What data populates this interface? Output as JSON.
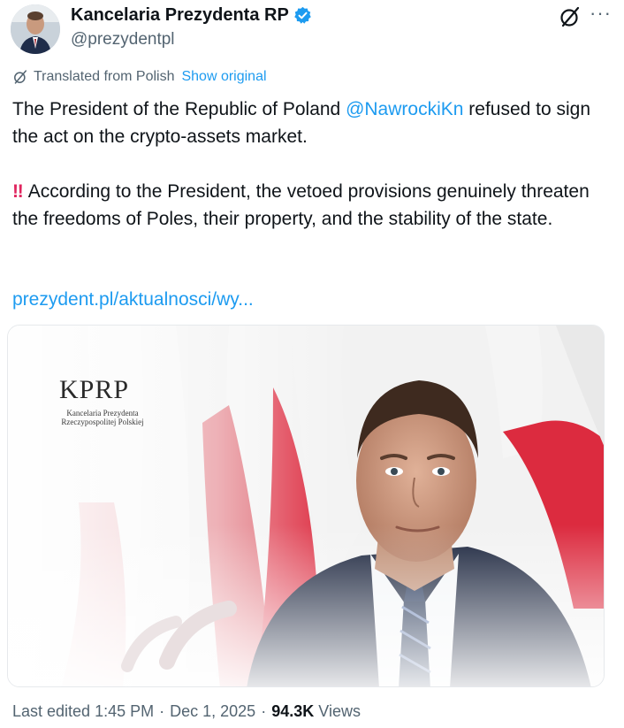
{
  "account": {
    "name": "Kancelaria Prezydenta RP",
    "handle": "@prezydentpl",
    "verified_icon": "verified-badge-icon"
  },
  "translation": {
    "label": "Translated from Polish",
    "show_original": "Show original"
  },
  "tweet": {
    "p1_start": "The President of the Republic of Poland ",
    "mention": "@NawrockiKn",
    "p1_end": " refused to sign the act on the crypto-assets market.",
    "bang": "‼",
    "p2": "According to the President, the vetoed provisions genuinely threaten the freedoms of Poles, their property, and the stability of the state.",
    "link": "prezydent.pl/aktualnosci/wy..."
  },
  "media": {
    "logo": "KPRP",
    "logo_sub": "Kancelaria Prezydenta Rzeczypospolitej Polskiej"
  },
  "footer": {
    "prefix": "Last edited ",
    "time": "1:45 PM",
    "sep1": " · ",
    "date": "Dec 1, 2025",
    "sep2": " · ",
    "views_count": "94.3K",
    "views_label": "Views"
  },
  "colors": {
    "accent": "#1d9bf0",
    "text": "#0f1419",
    "muted": "#536471",
    "flag_red": "#dc2b3f"
  }
}
